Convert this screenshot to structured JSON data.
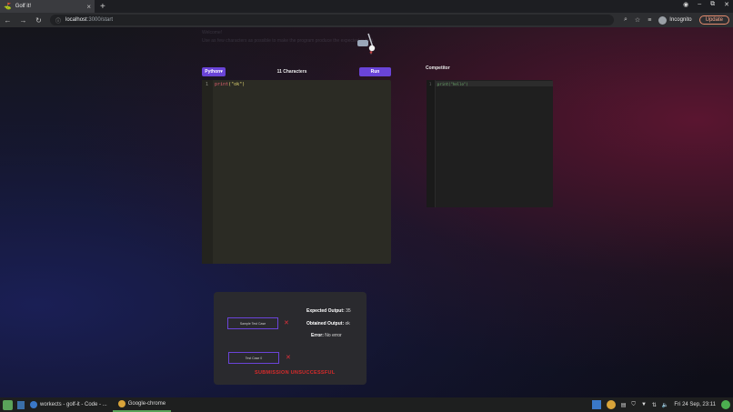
{
  "browser": {
    "tab_title": "Golf it!",
    "url_host": "localhost",
    "url_path": ":3000/start",
    "profile_label": "Incognito",
    "update_label": "Update"
  },
  "faded_text": {
    "line1": "Welcome!",
    "line2": "Use as few characters as possible to make the program produce the expected output."
  },
  "editor": {
    "language_label": "Python",
    "char_count": "11 Characters",
    "run_label": "Run",
    "line_number": "1",
    "code_keyword": "print",
    "code_rest": "(\"ok\")"
  },
  "competitor": {
    "label": "Competitor",
    "line_number": "1",
    "code": "print(\"hello\")"
  },
  "results": {
    "sample_case_label": "Sample Test Case",
    "test_case_label": "Test Case 0",
    "expected_label": "Expected Output:",
    "expected_value": "35",
    "obtained_label": "Obtained Output:",
    "obtained_value": "ok",
    "error_label": "Error:",
    "error_value": "No error",
    "status_message": "SUBMISSION UNSUCCESSFUL",
    "fail_symbol": "✕"
  },
  "taskbar": {
    "task1_label": "workects - golf-it - Code - ...",
    "task2_label": "Google-chrome",
    "clock": "Fri 24 Sep, 23:11"
  },
  "colors": {
    "accent": "#6a44d8",
    "error": "#d92b2b",
    "editor_bg": "#2b2b24"
  }
}
